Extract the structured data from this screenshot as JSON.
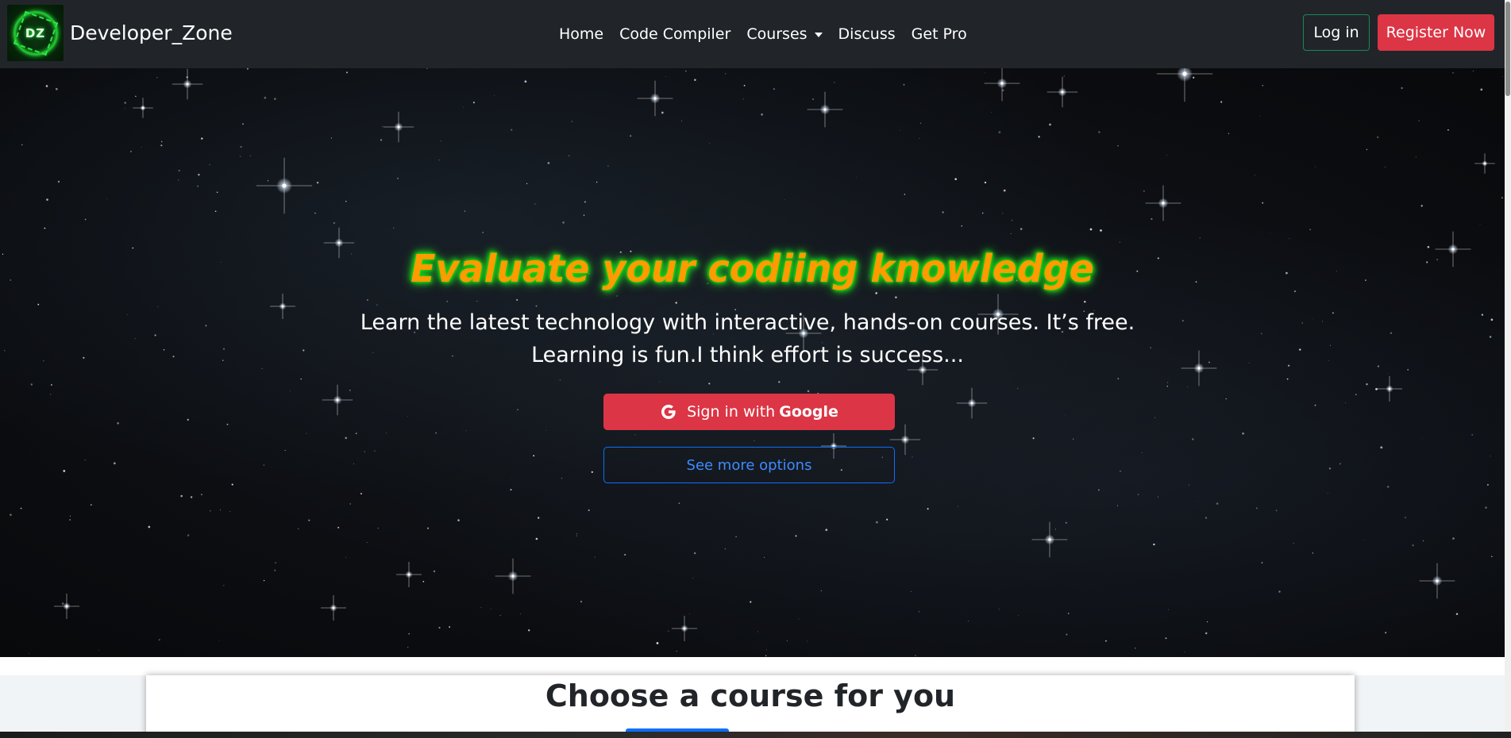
{
  "navbar": {
    "logo_text": "DZ",
    "brand_name": "Developer_Zone",
    "links": [
      {
        "label": "Home"
      },
      {
        "label": "Code Compiler"
      },
      {
        "label": "Courses"
      },
      {
        "label": "Discuss"
      },
      {
        "label": "Get Pro"
      }
    ],
    "login_label": "Log in",
    "register_label": "Register Now"
  },
  "hero": {
    "title": "Evaluate your codiing knowledge",
    "subtitle": "Learn the latest technology with interactive, hands-on courses. It’s free. Learning is fun.I think effort is success...",
    "google_prefix": "Sign in with",
    "google_brand": "Google",
    "more_options_label": "See more options"
  },
  "courses": {
    "heading": "Choose a course for you"
  },
  "colors": {
    "navbar_bg": "#212529",
    "danger": "#dc3545",
    "success": "#198754",
    "primary": "#0d6efd",
    "title_orange": "#ff9a00",
    "title_glow_green": "#1dbb1d"
  },
  "icons": {
    "google": "google-icon",
    "caret": "chevron-down-icon",
    "logo": "logo-icon"
  }
}
